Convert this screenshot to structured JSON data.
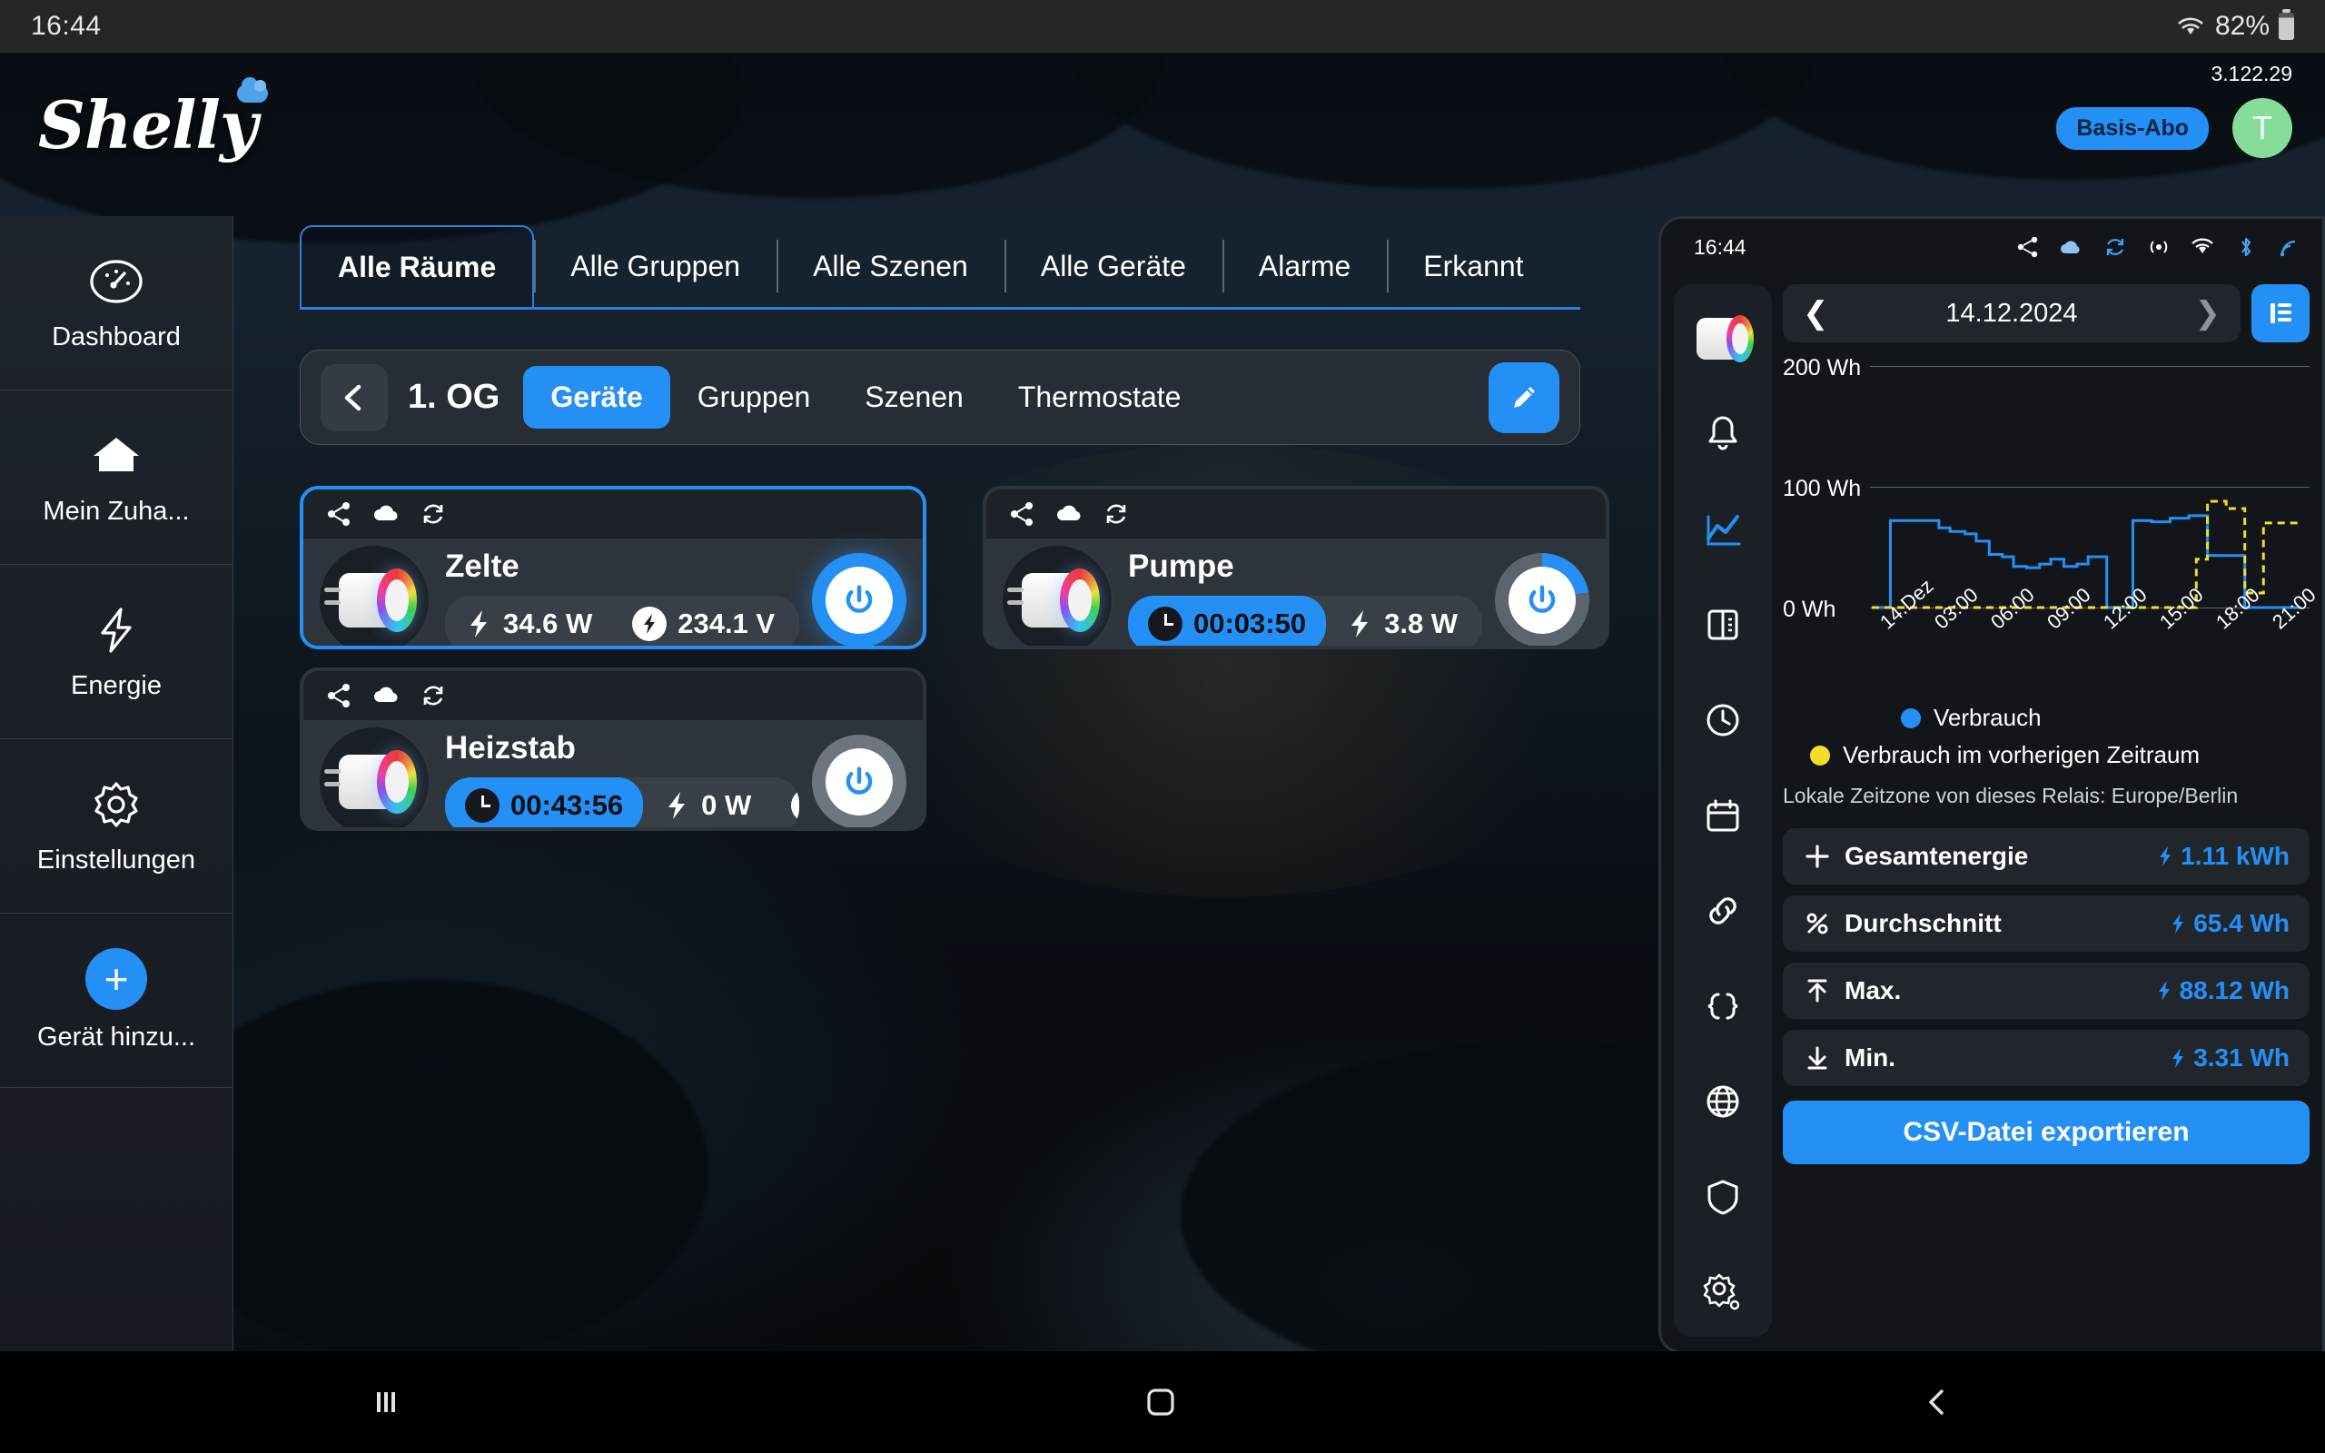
{
  "statusbar": {
    "time": "16:44",
    "battery": "82%",
    "wifi_icon": "wifi-icon",
    "battery_icon": "battery-icon"
  },
  "header": {
    "logo_text": "Shelly",
    "version": "3.122.29",
    "subscription_badge": "Basis-Abo",
    "avatar_initial": "T"
  },
  "sidebar": {
    "items": [
      {
        "label": "Dashboard",
        "icon": "gauge-icon"
      },
      {
        "label": "Mein Zuha...",
        "icon": "home-icon"
      },
      {
        "label": "Energie",
        "icon": "bolt-icon"
      },
      {
        "label": "Einstellungen",
        "icon": "gear-icon"
      },
      {
        "label": "Gerät hinzu...",
        "icon": "plus-icon"
      }
    ]
  },
  "main_tabs": [
    {
      "label": "Alle Räume",
      "active": true
    },
    {
      "label": "Alle Gruppen",
      "active": false
    },
    {
      "label": "Alle Szenen",
      "active": false
    },
    {
      "label": "Alle Geräte",
      "active": false
    },
    {
      "label": "Alarme",
      "active": false
    },
    {
      "label": "Erkannt",
      "active": false
    }
  ],
  "room_panel": {
    "back_icon": "chevron-left-icon",
    "room_name": "1. OG",
    "segments": [
      {
        "label": "Geräte",
        "active": true
      },
      {
        "label": "Gruppen",
        "active": false
      },
      {
        "label": "Szenen",
        "active": false
      },
      {
        "label": "Thermostate",
        "active": false
      }
    ],
    "edit_icon": "pencil-icon"
  },
  "devices": [
    {
      "name": "Zelte",
      "selected": true,
      "top_icons": [
        "share-icon",
        "cloud-icon",
        "refresh-icon"
      ],
      "metrics": [
        {
          "type": "power",
          "icon": "bolt-icon",
          "value": "34.6 W"
        },
        {
          "type": "voltage",
          "icon": "bolt-circle-icon",
          "value": "234.1 V"
        }
      ],
      "power_state": "on"
    },
    {
      "name": "Pumpe",
      "selected": false,
      "top_icons": [
        "share-icon",
        "cloud-icon",
        "refresh-icon"
      ],
      "metrics": [
        {
          "type": "timer",
          "icon": "clock-icon",
          "value": "00:03:50"
        },
        {
          "type": "power",
          "icon": "bolt-icon",
          "value": "3.8 W"
        },
        {
          "type": "voltage",
          "icon": "bolt-circle-icon",
          "value": ""
        }
      ],
      "power_state": "partial"
    },
    {
      "name": "Heizstab",
      "selected": false,
      "top_icons": [
        "share-icon",
        "cloud-icon",
        "refresh-icon"
      ],
      "metrics": [
        {
          "type": "timer",
          "icon": "clock-icon",
          "value": "00:43:56"
        },
        {
          "type": "power",
          "icon": "bolt-icon",
          "value": "0 W"
        },
        {
          "type": "voltage",
          "icon": "bolt-circle-icon",
          "value": ""
        }
      ],
      "power_state": "off"
    }
  ],
  "right_panel": {
    "statusbar_time": "16:44",
    "status_icons": [
      "share-icon",
      "cloud-icon",
      "refresh-icon",
      "broadcast-icon",
      "wifi-icon",
      "bluetooth-icon",
      "signal-icon"
    ],
    "rail_icons": [
      "device-plug-icon",
      "bell-icon",
      "chart-line-icon",
      "panel-icon",
      "clock-icon",
      "calendar-icon",
      "link-icon",
      "code-icon",
      "globe-icon",
      "shield-icon",
      "gear-settings-icon"
    ],
    "date_nav": {
      "prev_icon": "chevron-left-icon",
      "date": "14.12.2024",
      "next_icon": "chevron-right-icon"
    },
    "list_view_icon": "bar-list-icon",
    "legend": [
      {
        "label": "Verbrauch",
        "color": "#2490f5"
      },
      {
        "label": "Verbrauch im vorherigen Zeitraum",
        "color": "#f2dd29"
      }
    ],
    "timezone_note": "Lokale Zeitzone von dieses Relais: Europe/Berlin",
    "stats": [
      {
        "icon": "plus-icon",
        "label": "Gesamtenergie",
        "value": "1.11 kWh"
      },
      {
        "icon": "percent-icon",
        "label": "Durchschnitt",
        "value": "65.4 Wh"
      },
      {
        "icon": "arrow-up-icon",
        "label": "Max.",
        "value": "88.12 Wh"
      },
      {
        "icon": "arrow-down-icon",
        "label": "Min.",
        "value": "3.31 Wh"
      }
    ],
    "export_button": "CSV-Datei exportieren"
  },
  "chart_data": {
    "type": "line",
    "title": "",
    "xlabel": "",
    "ylabel": "Wh",
    "ylim": [
      0,
      200
    ],
    "yticks": [
      0,
      100,
      200
    ],
    "ytick_labels": [
      "0 Wh",
      "100 Wh",
      "200 Wh"
    ],
    "xtick_labels": [
      "14.Dez",
      "03:00",
      "06:00",
      "09:00",
      "12:00",
      "15:00",
      "18:00",
      "21:00"
    ],
    "grid": true,
    "legend_position": "bottom",
    "series": [
      {
        "name": "Verbrauch",
        "color": "#2490f5",
        "style": "step-solid",
        "x": [
          0,
          0.6,
          1,
          2,
          3,
          3.6,
          4.2,
          5,
          5.6,
          6.3,
          7,
          7.6,
          8.3,
          9,
          9.6,
          10.3,
          11,
          11.6,
          12.2,
          12.6,
          13.3,
          14,
          15,
          16,
          17,
          17.6,
          18,
          19,
          20,
          21,
          22,
          23
        ],
        "values": [
          0,
          0,
          72,
          72,
          72,
          66,
          63,
          61,
          55,
          44,
          42,
          34,
          33,
          36,
          40,
          34,
          36,
          42,
          42,
          0,
          0,
          72,
          71,
          74,
          76,
          76,
          43,
          43,
          0,
          0,
          0,
          0
        ]
      },
      {
        "name": "Verbrauch im vorherigen Zeitraum",
        "color": "#f2dd29",
        "style": "step-dashed",
        "x": [
          0,
          1,
          2,
          3,
          4,
          5,
          6,
          7,
          8,
          9,
          10,
          11,
          12,
          13,
          14,
          15,
          16,
          17,
          17.4,
          18,
          18.6,
          19,
          19.6,
          20,
          20.6,
          21,
          22,
          23
        ],
        "values": [
          0,
          0,
          0,
          0,
          0,
          0,
          0,
          0,
          0,
          0,
          0,
          0,
          0,
          0,
          0,
          0,
          0,
          0,
          40,
          88,
          88,
          82,
          82,
          12,
          12,
          70,
          70,
          70
        ]
      }
    ]
  },
  "navbar": {
    "recent_icon": "recents-icon",
    "home_icon": "home-circle-icon",
    "back_icon": "back-icon"
  }
}
